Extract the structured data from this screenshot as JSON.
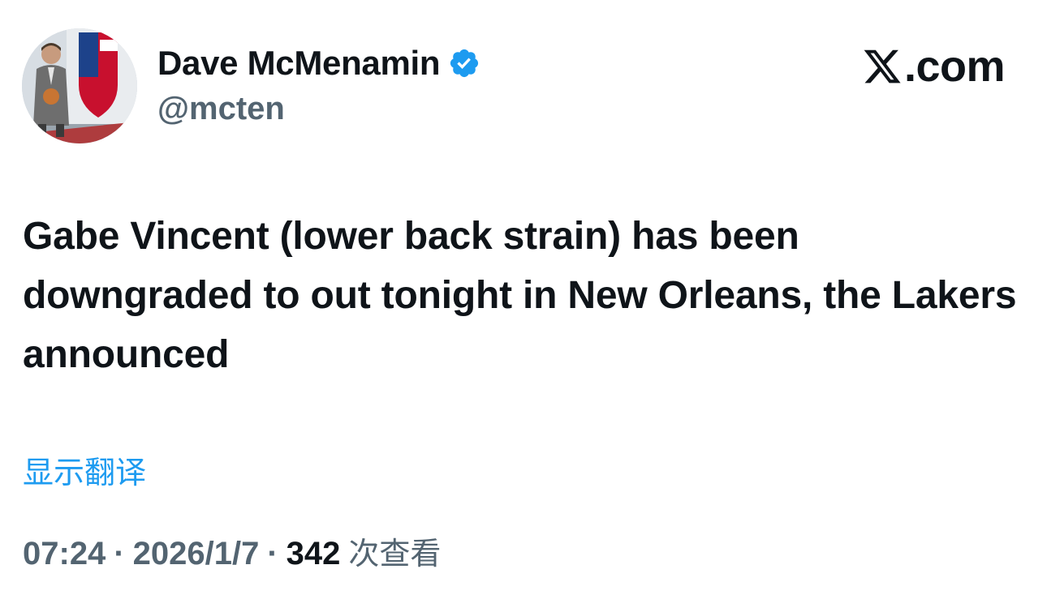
{
  "author": {
    "display_name": "Dave McMenamin",
    "handle": "@mcten",
    "verified": true,
    "verified_color": "#1d9bf0",
    "avatar_icon": "profile-photo"
  },
  "brand": {
    "logo_icon": "x-logo-icon",
    "text": ".com"
  },
  "tweet": {
    "text": "Gabe Vincent (lower back strain) has been downgraded to out tonight in New Orleans, the Lakers announced"
  },
  "translate_link": "显示翻译",
  "meta": {
    "time": "07:24",
    "separator": "·",
    "date": "2026/1/7",
    "views_count": "342",
    "views_label": "次查看"
  },
  "colors": {
    "text_primary": "#0f1419",
    "text_secondary": "#536471",
    "link": "#1d9bf0"
  }
}
